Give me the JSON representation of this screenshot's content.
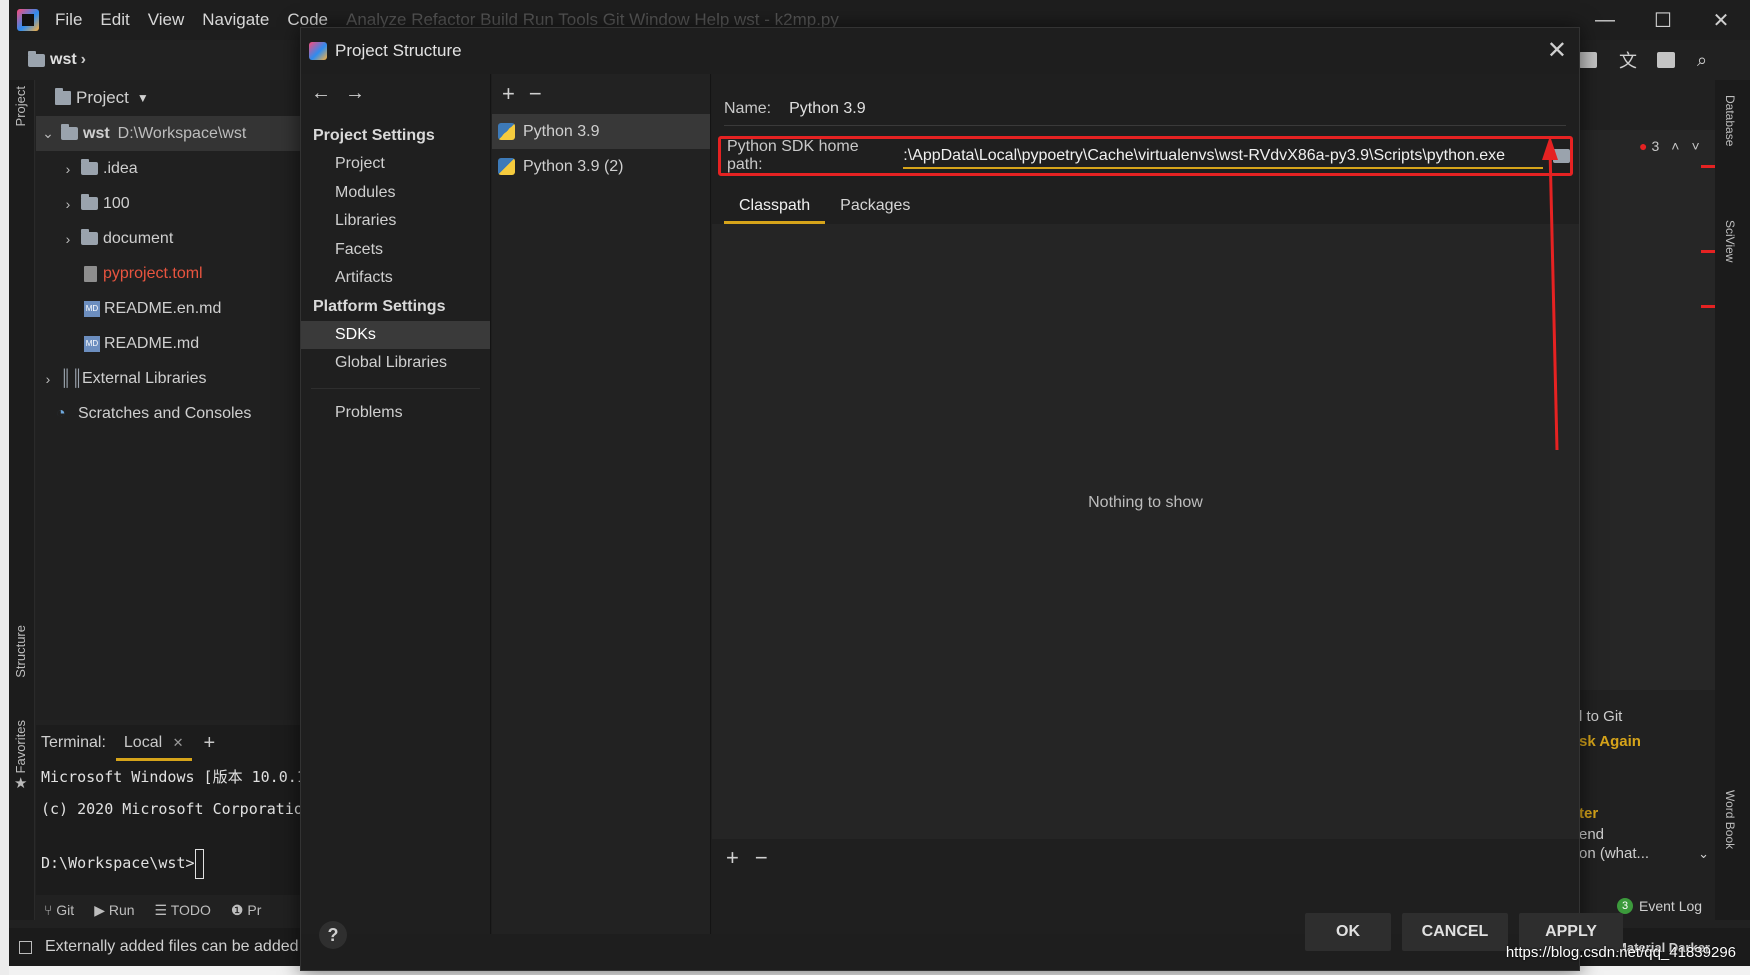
{
  "menubar": {
    "items": [
      "File",
      "Edit",
      "View",
      "Navigate",
      "Code"
    ],
    "faded": "Analyze  Refactor  Build  Run  Tools  Git  Window  Help       wst - k2mp.py"
  },
  "breadcrumb": {
    "project": "wst"
  },
  "tool_strip": {
    "project": "Project",
    "structure": "Structure",
    "favorites": "Favorites"
  },
  "project_panel": {
    "header": "Project",
    "root_name": "wst",
    "root_path": "D:\\Workspace\\wst",
    "items": [
      {
        "label": ".idea",
        "type": "folder"
      },
      {
        "label": "100",
        "type": "folder"
      },
      {
        "label": "document",
        "type": "folder"
      },
      {
        "label": "pyproject.toml",
        "type": "file"
      },
      {
        "label": "README.en.md",
        "type": "md"
      },
      {
        "label": "README.md",
        "type": "md"
      }
    ],
    "external": "External Libraries",
    "scratches": "Scratches and Consoles"
  },
  "terminal": {
    "label": "Terminal:",
    "tab": "Local",
    "lines": [
      "Microsoft Windows [版本 10.0.1",
      "(c) 2020 Microsoft Corporation",
      "D:\\Workspace\\wst>"
    ]
  },
  "bottom_tools": [
    "Git",
    "Run",
    "TODO",
    "Pr"
  ],
  "status": {
    "text": "Externally added files can be added",
    "theme": "Material Darker"
  },
  "right_panel": {
    "error_count": "3",
    "database": "Database",
    "sciview": "SciView",
    "wordbook": "Word Book",
    "to_git": "l to Git",
    "ask_again": "sk Again",
    "ter": "ter",
    "end": "end",
    "what": "on (what...",
    "event_log_count": "3",
    "event_log": "Event Log"
  },
  "dialog": {
    "title": "Project Structure",
    "project_settings": "Project Settings",
    "project_items": [
      "Project",
      "Modules",
      "Libraries",
      "Facets",
      "Artifacts"
    ],
    "platform_settings": "Platform Settings",
    "platform_items": [
      "SDKs",
      "Global Libraries"
    ],
    "problems": "Problems",
    "sdks": [
      "Python 3.9",
      "Python 3.9 (2)"
    ],
    "name_label": "Name:",
    "name_value": "Python 3.9",
    "sdk_path_label": "Python SDK home path:",
    "sdk_path_value": ":\\AppData\\Local\\pypoetry\\Cache\\virtualenvs\\wst-RVdvX86a-py3.9\\Scripts\\python.exe",
    "tabs": [
      "Classpath",
      "Packages"
    ],
    "empty": "Nothing to show",
    "ok": "OK",
    "cancel": "CANCEL",
    "apply": "APPLY",
    "help": "?"
  },
  "watermark": "https://blog.csdn.net/qq_41839296",
  "colors": {
    "highlight_red": "#e52222",
    "accent": "#d6a41a",
    "modified_file": "#e8543f"
  }
}
